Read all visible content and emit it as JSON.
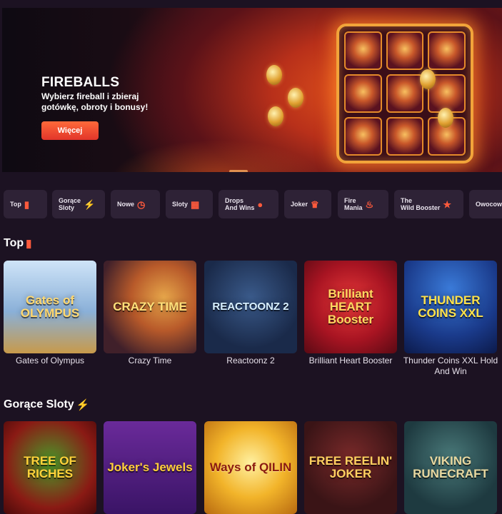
{
  "banner": {
    "title": "FIREBALLS",
    "subtitle": "Wybierz fireball i zbieraj gotówkę, obroty i bonusy!",
    "button": "Więcej"
  },
  "categories": [
    {
      "label": "Top",
      "icon": "chart-icon"
    },
    {
      "label": "Gorące\nSloty",
      "icon": "lightning-icon"
    },
    {
      "label": "Nowe",
      "icon": "clock-icon"
    },
    {
      "label": "Sloty",
      "icon": "slot-machine-icon"
    },
    {
      "label": "Drops\nAnd Wins",
      "icon": "bomb-icon"
    },
    {
      "label": "Joker",
      "icon": "crown-icon"
    },
    {
      "label": "Fire\nMania",
      "icon": "flame-icon"
    },
    {
      "label": "The\nWild Booster",
      "icon": "star-icon"
    },
    {
      "label": "Owocowe",
      "icon": "fruit-icon"
    }
  ],
  "sections": [
    {
      "title": "Top",
      "icon": "chart-icon",
      "games": [
        {
          "name": "Gates of Olympus",
          "art": "Gates of OLYMPUS"
        },
        {
          "name": "Crazy Time",
          "art": "CRAZY TIME"
        },
        {
          "name": "Reactoonz 2",
          "art": "REACTOONZ 2"
        },
        {
          "name": "Brilliant Heart Booster",
          "art": "Brilliant HEART Booster"
        },
        {
          "name": "Thunder Coins XXL Hold And Win",
          "art": "THUNDER COINS XXL"
        }
      ]
    },
    {
      "title": "Gorące Sloty",
      "icon": "lightning-icon",
      "games": [
        {
          "name": "Tree of Riches",
          "art": "TREE OF RICHES"
        },
        {
          "name": "Joker's Jewels",
          "art": "Joker's Jewels"
        },
        {
          "name": "Ways of Qilin",
          "art": "Ways of QILIN"
        },
        {
          "name": "Free Reelin' Joker",
          "art": "FREE REELIN' JOKER"
        },
        {
          "name": "Viking Runecraft",
          "art": "VIKING RUNECRAFT"
        }
      ]
    }
  ],
  "colors": {
    "background": "#1c1222",
    "accent": "#ff5a3c",
    "chip": "#2e2236"
  }
}
